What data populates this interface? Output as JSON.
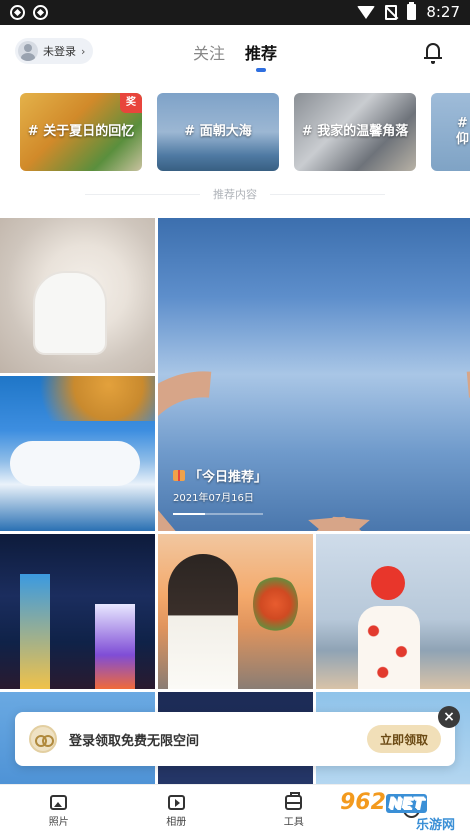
{
  "status_bar": {
    "time": "8:27"
  },
  "header": {
    "login_label": "未登录",
    "login_chevron": "›",
    "tabs": [
      {
        "label": "关注",
        "active": false
      },
      {
        "label": "推荐",
        "active": true
      }
    ]
  },
  "topics": [
    {
      "label": "# 关于夏日的回忆",
      "badge": "奖"
    },
    {
      "label": "# 面朝大海"
    },
    {
      "label": "# 我家的温馨角落"
    },
    {
      "label": "# 仰"
    }
  ],
  "section_title": "推荐内容",
  "featured": {
    "title": "「今日推荐」",
    "date": "2021年07月16日",
    "progress": 0.35
  },
  "banner": {
    "text": "登录领取免费无限空间",
    "button": "立即领取",
    "close": "×"
  },
  "bottom_nav": [
    {
      "label": "照片",
      "icon": "photo-icon"
    },
    {
      "label": "相册",
      "icon": "album-icon"
    },
    {
      "label": "工具",
      "icon": "toolbox-icon"
    },
    {
      "label": "",
      "icon": "mine-icon"
    }
  ],
  "watermark": {
    "logo": "962",
    "logo_suffix": "NET",
    "sub": "乐游网"
  },
  "colors": {
    "accent": "#2f6fe0",
    "badge": "#e8453c",
    "claim_button": "#f1dfb8"
  }
}
